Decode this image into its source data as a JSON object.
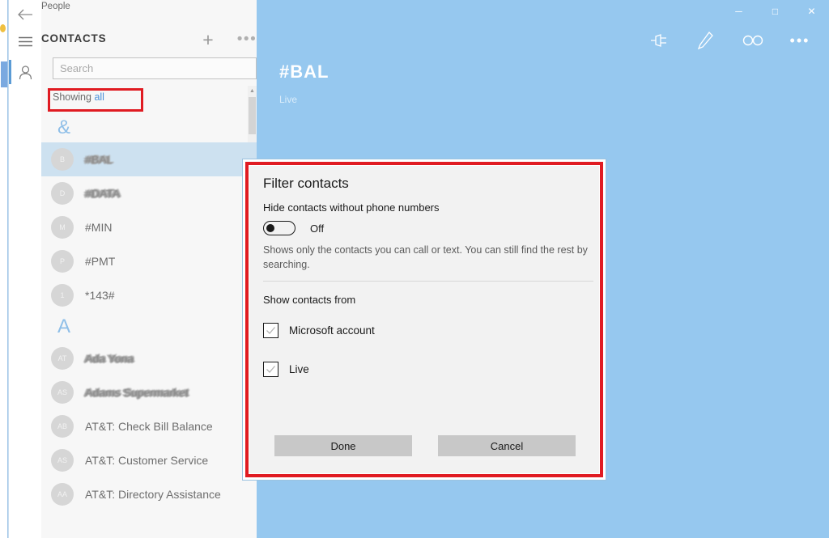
{
  "window": {
    "app_title": "People",
    "minimize_label": "─",
    "maximize_label": "□",
    "close_label": "✕"
  },
  "rail": {
    "back_name": "back-arrow-icon",
    "menu_name": "hamburger-menu-icon",
    "person_name": "person-icon"
  },
  "contacts": {
    "header_label": "CONTACTS",
    "add_label": "+",
    "more_label": "•••",
    "search_placeholder": "Search",
    "search_value": "",
    "showing_prefix": "Showing ",
    "showing_link": "all",
    "groups": [
      {
        "letter": "&",
        "items": [
          {
            "initials": "B",
            "name": "#BAL",
            "selected": true,
            "redacted": true
          },
          {
            "initials": "D",
            "name": "#DATA",
            "selected": false,
            "redacted": true
          },
          {
            "initials": "M",
            "name": "#MIN",
            "selected": false,
            "redacted": false
          },
          {
            "initials": "P",
            "name": "#PMT",
            "selected": false,
            "redacted": false
          },
          {
            "initials": "1",
            "name": "*143#",
            "selected": false,
            "redacted": false
          }
        ]
      },
      {
        "letter": "A",
        "items": [
          {
            "initials": "AT",
            "name": "Ada Yona",
            "selected": false,
            "redacted": true
          },
          {
            "initials": "AS",
            "name": "Adams Supermarket",
            "selected": false,
            "redacted": true
          },
          {
            "initials": "AB",
            "name": "AT&T: Check Bill Balance",
            "selected": false,
            "redacted": false
          },
          {
            "initials": "AS",
            "name": "AT&T: Customer Service",
            "selected": false,
            "redacted": false
          },
          {
            "initials": "AA",
            "name": "AT&T: Directory Assistance",
            "selected": false,
            "redacted": false
          }
        ]
      }
    ]
  },
  "detail": {
    "title": "#BAL",
    "subtitle": "Live",
    "toolbar": [
      {
        "name": "pin-icon",
        "label": "Pin"
      },
      {
        "name": "edit-icon",
        "label": "Edit"
      },
      {
        "name": "link-icon",
        "label": "Link"
      },
      {
        "name": "more-icon",
        "label": "•••"
      }
    ]
  },
  "dialog": {
    "title": "Filter contacts",
    "hide_label": "Hide contacts without phone numbers",
    "toggle_state": "Off",
    "toggle_on": false,
    "description": "Shows only the contacts you can call or text. You can still find the rest by searching.",
    "show_from_label": "Show contacts from",
    "accounts": [
      {
        "label": "Microsoft account",
        "checked": true
      },
      {
        "label": "Live",
        "checked": true
      }
    ],
    "done_label": "Done",
    "cancel_label": "Cancel"
  },
  "colors": {
    "accent_blue": "#96c8ef",
    "selection_blue": "#cde1f0",
    "annotation_red": "#e01b22",
    "dialog_bg": "#f2f2f2",
    "button_gray": "#c8c8c8"
  }
}
